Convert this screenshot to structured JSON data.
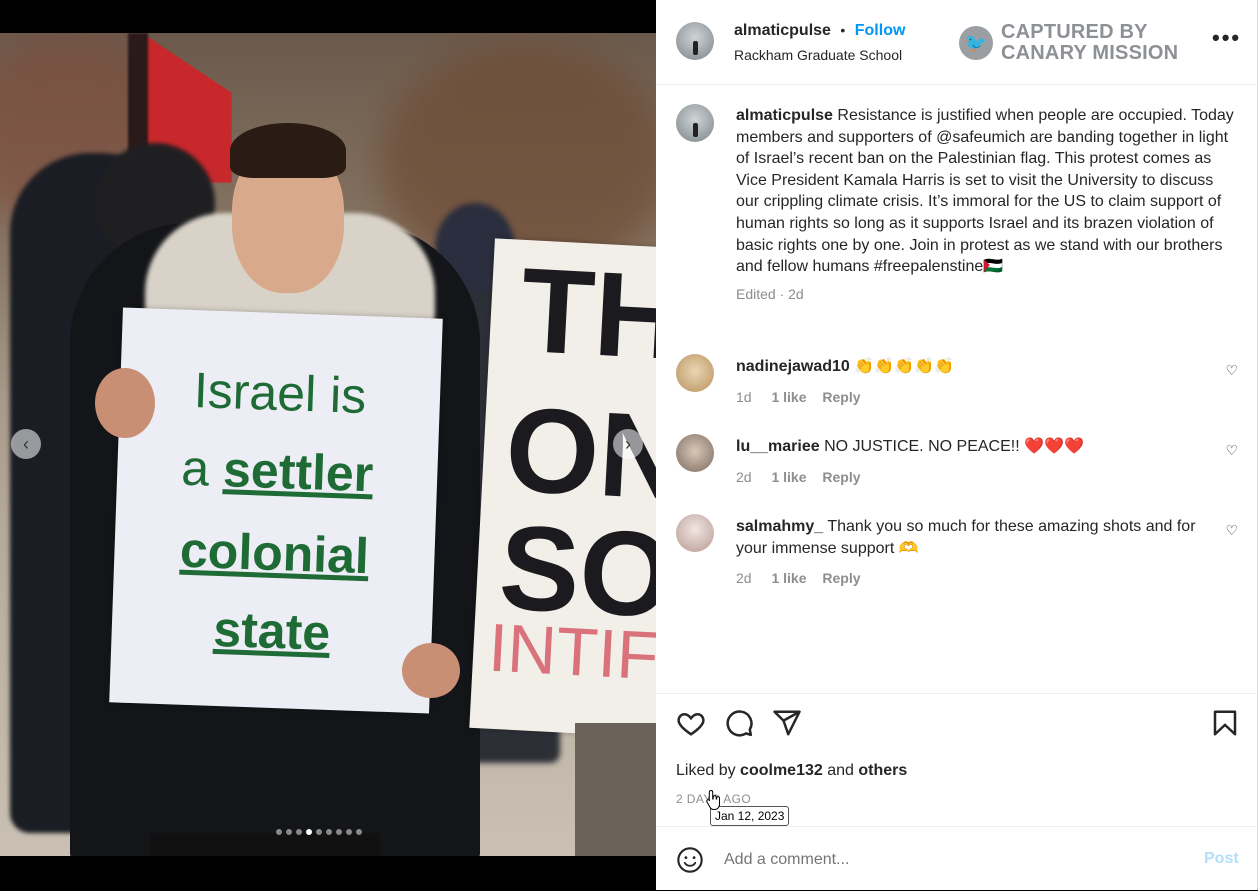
{
  "media": {
    "sign_main": {
      "line1": "Israel is",
      "line2_prefix": "a",
      "line2_underlined": "settler",
      "line3": "colonial",
      "line4": "state"
    },
    "sign_side": {
      "line1": "TH",
      "line2": "ON",
      "line3": "SO",
      "line4": "INTIF"
    },
    "carousel": {
      "total": 9,
      "active_index": 3
    },
    "prev_icon": "chevron-left-icon",
    "next_icon": "chevron-right-icon"
  },
  "header": {
    "username": "almaticpulse",
    "separator": "•",
    "follow_label": "Follow",
    "location": "Rackham Graduate School",
    "watermark_line1": "CAPTURED BY",
    "watermark_line2": "CANARY MISSION",
    "more_icon": "more-horizontal-icon"
  },
  "caption": {
    "username": "almaticpulse",
    "text": "Resistance is justified when people are occupied. Today members and supporters of @safeumich are banding together in light of Israel’s recent ban on the Palestinian flag. This protest comes as Vice President Kamala Harris is set to visit the University to discuss our crippling climate crisis. It’s immoral for the US to claim support of human rights so long as it supports Israel and its brazen violation of basic rights one by one. Join in protest as we stand with our brothers and fellow humans #freepalenstine",
    "flag": "🇵🇸",
    "meta": "Edited · 2d"
  },
  "comments": [
    {
      "username": "nadinejawad10",
      "text": "👏👏👏👏👏",
      "age": "1d",
      "likes": "1 like",
      "reply": "Reply"
    },
    {
      "username": "lu__mariee",
      "text": "NO JUSTICE. NO PEACE!! ❤️❤️❤️",
      "age": "2d",
      "likes": "1 like",
      "reply": "Reply"
    },
    {
      "username": "salmahmy_",
      "text": "Thank you so much for these amazing shots and for your immense support 🫶",
      "age": "2d",
      "likes": "1 like",
      "reply": "Reply"
    }
  ],
  "actions": {
    "like_icon": "heart-icon",
    "comment_icon": "comment-icon",
    "share_icon": "send-icon",
    "save_icon": "bookmark-icon",
    "liked_by_prefix": "Liked by",
    "liked_by_user": "coolme132",
    "liked_by_and": "and",
    "liked_by_others": "others",
    "timestamp": "2 DAYS AGO",
    "tooltip": "Jan 12, 2023"
  },
  "comment_box": {
    "emoji_icon": "smiley-icon",
    "placeholder": "Add a comment...",
    "post_label": "Post"
  }
}
